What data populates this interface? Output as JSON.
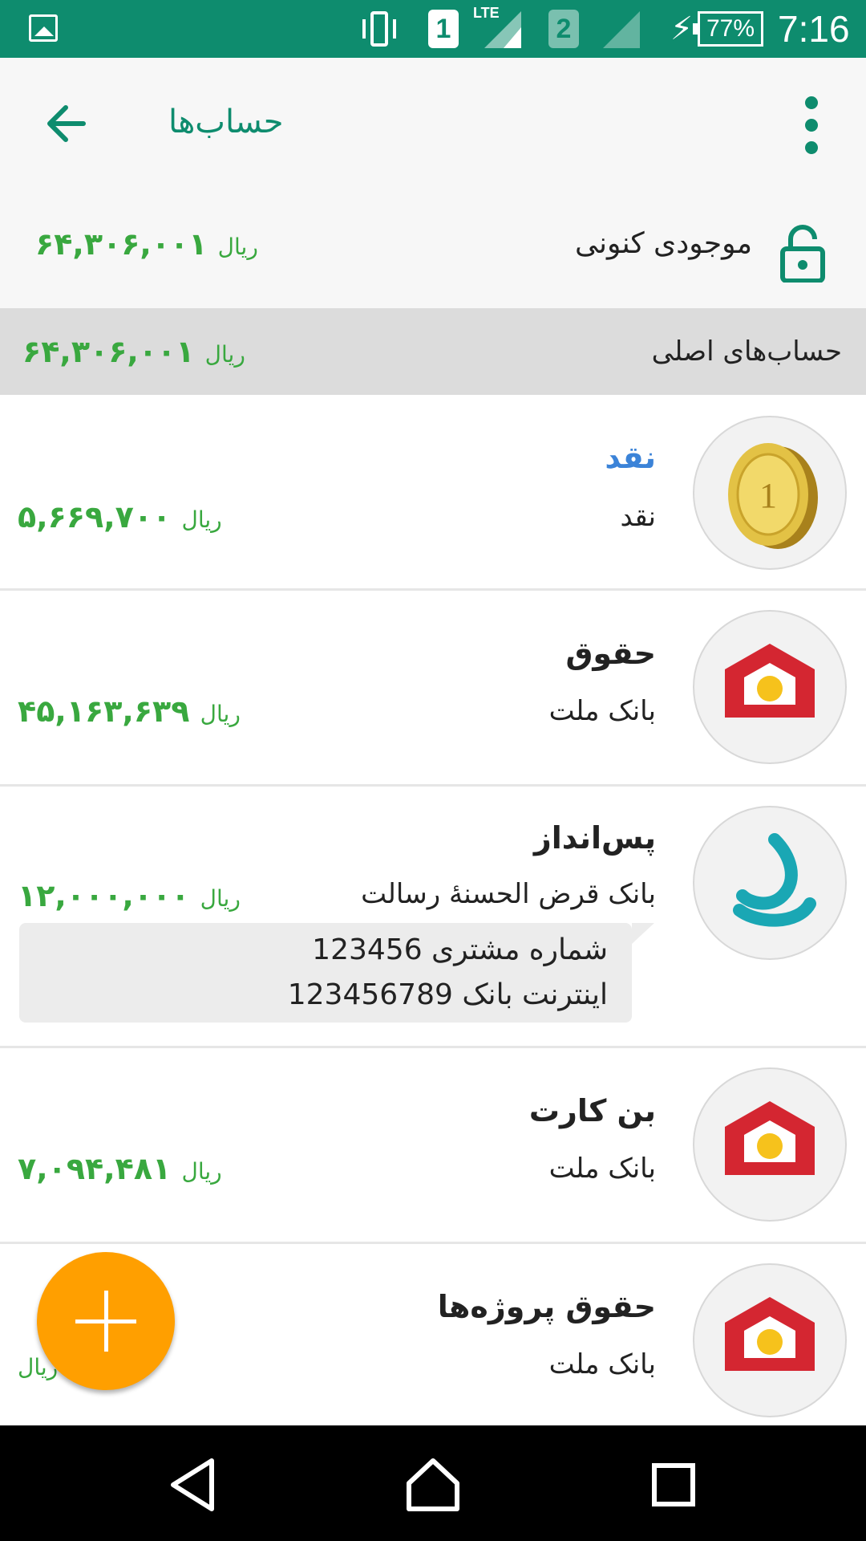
{
  "status_bar": {
    "sim1": "1",
    "sim2": "2",
    "network": "LTE",
    "battery": "77%",
    "time": "7:16"
  },
  "app_bar": {
    "title": "حساب‌ها",
    "back_icon": "arrow-left-icon",
    "menu_icon": "more-vert-icon"
  },
  "balance": {
    "label": "موجودی کنونی",
    "amount": "۶۴,۳۰۶,۰۰۱",
    "unit": "ریال",
    "icon": "lock-icon"
  },
  "section": {
    "label": "حساب‌های اصلی",
    "amount": "۶۴,۳۰۶,۰۰۱",
    "unit": "ریال"
  },
  "accounts": [
    {
      "name": "نقد",
      "bank": "نقد",
      "amount": "۵,۶۶۹,۷۰۰",
      "unit": "ریال",
      "icon": "gold-coin-icon"
    },
    {
      "name": "حقوق",
      "bank": "بانک ملت",
      "amount": "۴۵,۱۶۳,۶۳۹",
      "unit": "ریال",
      "icon": "bank-mellat-logo"
    },
    {
      "name": "پس‌انداز",
      "bank": "بانک قرض الحسنهٔ رسالت",
      "amount": "۱۲,۰۰۰,۰۰۰",
      "unit": "ریال",
      "icon": "bank-resalat-logo",
      "note": {
        "line1": "شماره مشتری 123456",
        "line2": "اینترنت بانک 123456789"
      }
    },
    {
      "name": "بن کارت",
      "bank": "بانک ملت",
      "amount": "۷,۰۹۴,۴۸۱",
      "unit": "ریال",
      "icon": "bank-mellat-logo"
    },
    {
      "name": "حقوق پروژه‌ها",
      "bank": "بانک ملت",
      "amount": "",
      "unit": "ریال",
      "icon": "bank-mellat-logo"
    }
  ],
  "fab": {
    "icon": "plus-icon"
  },
  "nav_bar": {
    "back_icon": "nav-back-icon",
    "home_icon": "nav-home-icon",
    "recents_icon": "nav-recents-icon"
  },
  "colors": {
    "primary": "#0e8c6e",
    "amount_green": "#39a83f",
    "fab_orange": "#ff9f00",
    "cash_blue": "#3b83d8",
    "mellat_red": "#d42631",
    "resalat_teal": "#1aa7b4"
  }
}
